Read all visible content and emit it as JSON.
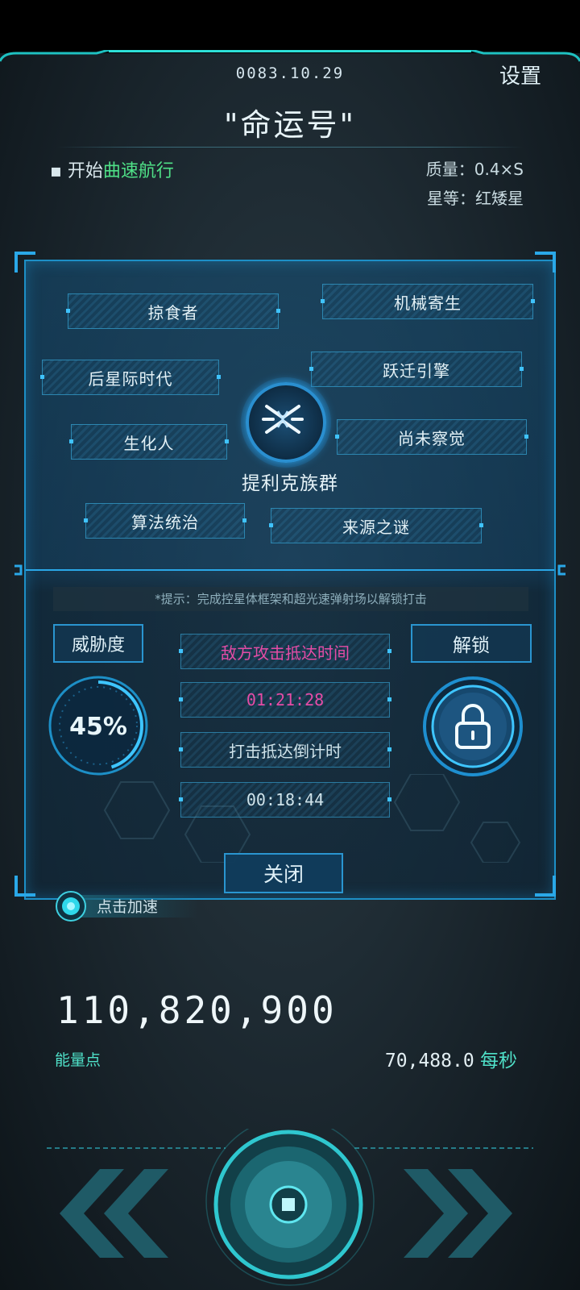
{
  "header": {
    "date": "0083.10.29",
    "settings_label": "设置",
    "ship_name": "\"命运号\""
  },
  "status": {
    "cruise_prefix": "开始",
    "cruise_highlight": "曲速航行",
    "mass": "质量：0.4×S",
    "star_class": "星等：红矮星"
  },
  "traits": [
    "掠食者",
    "机械寄生",
    "后星际时代",
    "跃迁引擎",
    "生化人",
    "尚未察觉",
    "算法统治",
    "来源之谜"
  ],
  "faction": {
    "name": "提利克族群"
  },
  "panel": {
    "hint": "*提示：完成控星体框架和超光速弹射场以解锁打击",
    "threat_label": "威胁度",
    "threat_value": "45%",
    "threat_level": 0.45,
    "unlock_label": "解锁",
    "enemy_arrival_label": "敌方攻击抵达时间",
    "enemy_arrival_time": "01:21:28",
    "strike_countdown_label": "打击抵达倒计时",
    "strike_countdown_time": "00:18:44",
    "close_label": "关闭"
  },
  "accelerate": {
    "label": "点击加速"
  },
  "energy": {
    "value": "110,820,900",
    "label": "能量点",
    "rate_value": "70,488.0",
    "rate_unit": "每秒"
  },
  "colors": {
    "accent": "#2a95d0",
    "highlight_green": "#4fe087",
    "alert_pink": "#e44ca6",
    "teal": "#4fe0c8"
  }
}
